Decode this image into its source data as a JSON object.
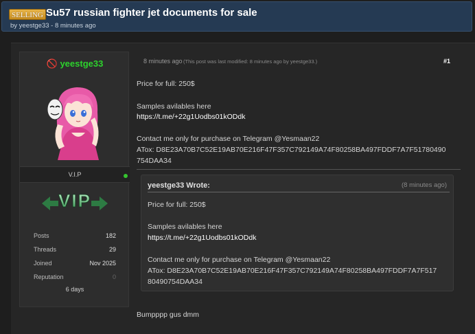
{
  "thread": {
    "prefix": "SELLING",
    "title": "Su57 russian fighter jet documents for sale",
    "meta": "by yeestge33 - 8 minutes ago"
  },
  "author": {
    "name": "🚫 yeestge33",
    "usertitle": "V.I.P",
    "badge_text": "VIP",
    "stats": [
      {
        "key": "Posts",
        "value": "182"
      },
      {
        "key": "Threads",
        "value": "29"
      },
      {
        "key": "Joined",
        "value": "Nov 2025"
      },
      {
        "key": "Reputation",
        "value": "0"
      }
    ],
    "last_visit": "6 days"
  },
  "post": {
    "time": "8 minutes ago",
    "edited": "(This post was last modified: 8 minutes ago by yeestge33.)",
    "number": "#1",
    "lines": {
      "price": "Price for full: 250$",
      "samples": "Samples avilables here",
      "link": "https://t.me/+22g1Uodbs01kODdk",
      "contact": "Contact me only for purchase on Telegram @Yesmaan22",
      "atox1": "ATox: D8E23A70B7C52E19AB70E216F47F357C792149A74F80258BA497FDDF7A7F51780490",
      "atox2": "754DAA34"
    },
    "quote": {
      "author": "yeestge33 Wrote:",
      "time": "(8 minutes ago)",
      "price": "Price for full: 250$",
      "samples": "Samples avilables here",
      "link": "https://t.me/+22g1Uodbs01kODdk",
      "contact": "Contact me only for purchase on Telegram @Yesmaan22",
      "atox1": "ATox: D8E23A70B7C52E19AB70E216F47F357C792149A74F80258BA497FDDF7A7F517",
      "atox2": "80490754DAA34"
    },
    "bump": "Bumpppp gus dmm"
  },
  "colors": {
    "header_bg": "#253a53",
    "username": "#2dd22d",
    "online": "#35c42f"
  }
}
